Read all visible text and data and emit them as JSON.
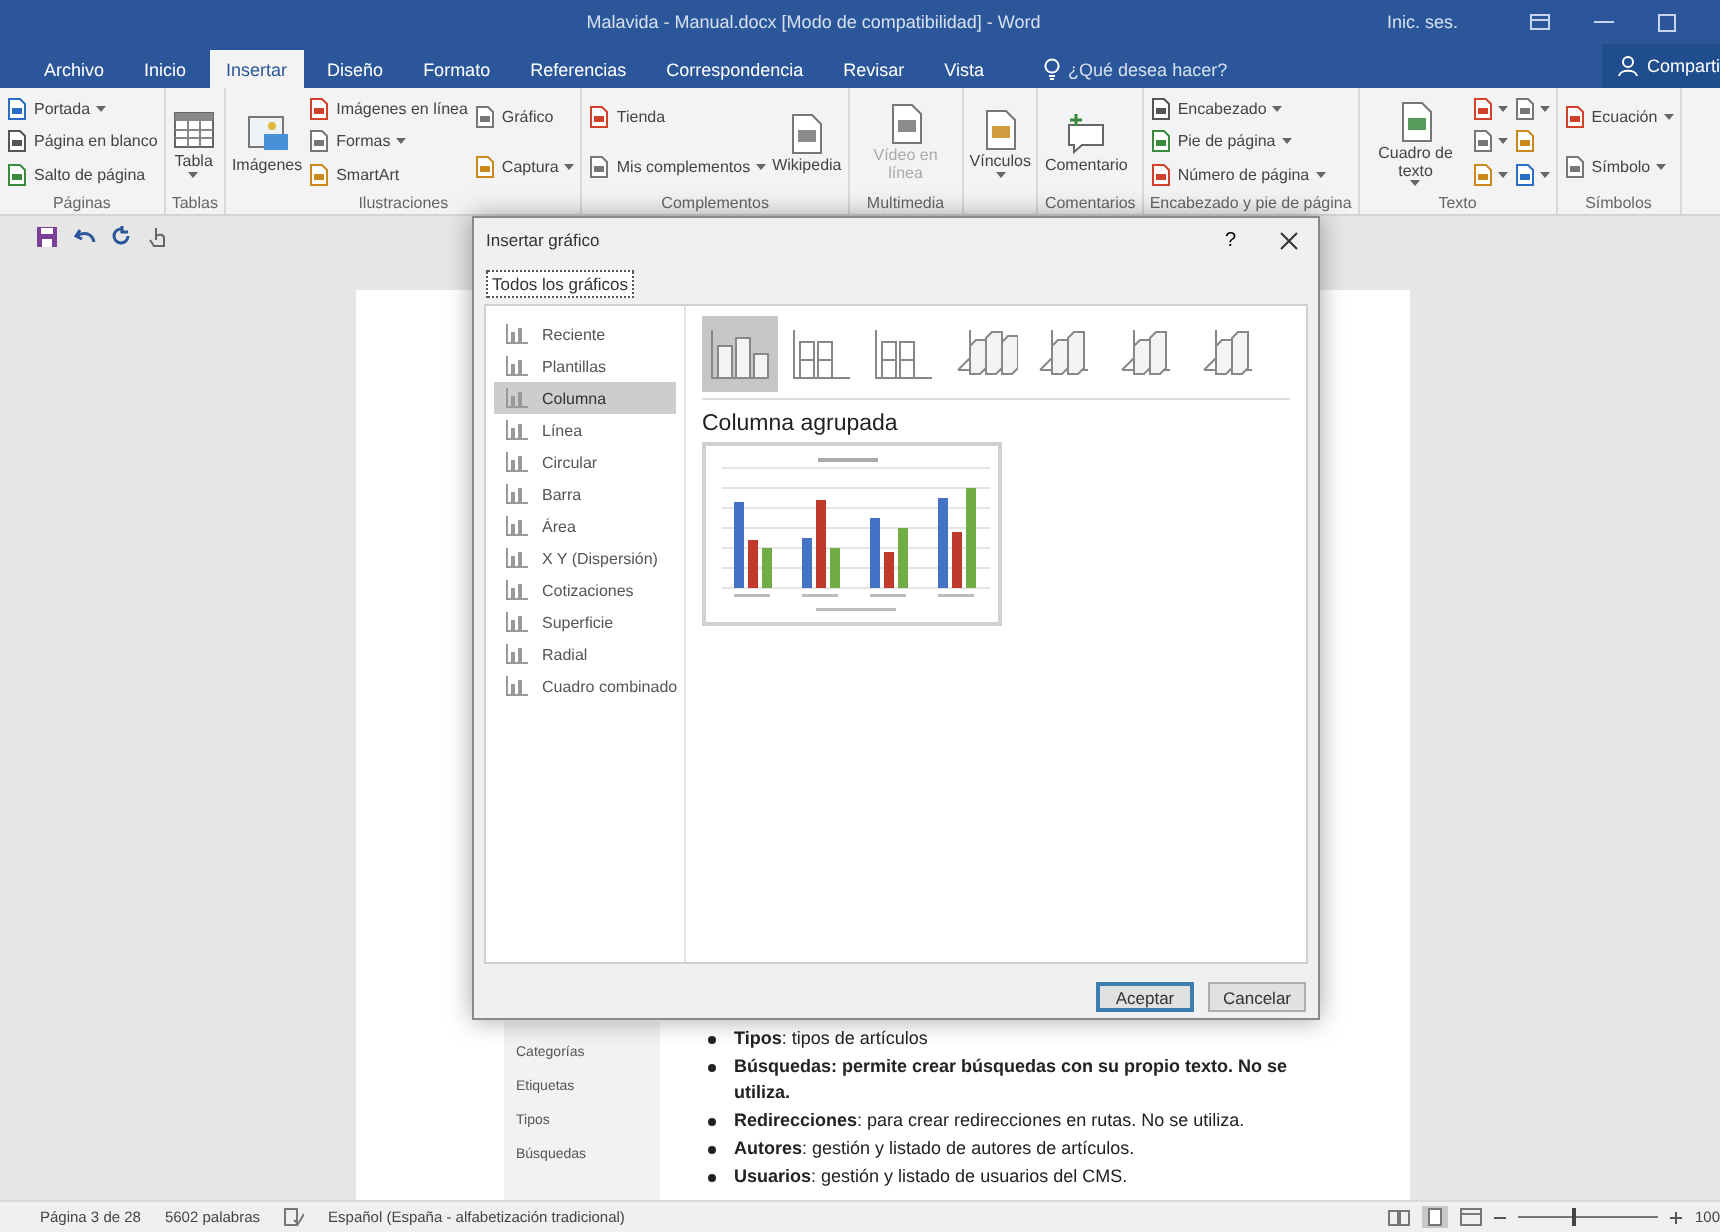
{
  "window": {
    "title": "Malavida - Manual.docx [Modo de compatibilidad] - Word",
    "account": "Inic. ses."
  },
  "tabs": [
    {
      "label": "Archivo",
      "selected": false
    },
    {
      "label": "Inicio",
      "selected": false
    },
    {
      "label": "Insertar",
      "selected": true
    },
    {
      "label": "Diseño",
      "selected": false
    },
    {
      "label": "Formato",
      "selected": false
    },
    {
      "label": "Referencias",
      "selected": false
    },
    {
      "label": "Correspondencia",
      "selected": false
    },
    {
      "label": "Revisar",
      "selected": false
    },
    {
      "label": "Vista",
      "selected": false
    }
  ],
  "tell_me": {
    "placeholder": "¿Qué desea hacer?"
  },
  "share_button": "Comparti",
  "ribbon_groups": [
    {
      "label": "Páginas",
      "columns": [
        [
          {
            "kind": "small",
            "label": "Portada",
            "dropdown": true,
            "disabled": false
          },
          {
            "kind": "small",
            "label": "Página en blanco",
            "dropdown": false,
            "disabled": false
          },
          {
            "kind": "small",
            "label": "Salto de página",
            "dropdown": false,
            "disabled": false
          }
        ]
      ]
    },
    {
      "label": "Tablas",
      "columns": [
        [
          {
            "kind": "large",
            "label": "Tabla",
            "dropdown": true,
            "disabled": false
          }
        ]
      ]
    },
    {
      "label": "Ilustraciones",
      "columns": [
        [
          {
            "kind": "large",
            "label": "Imágenes",
            "dropdown": false,
            "disabled": false
          }
        ],
        [
          {
            "kind": "small",
            "label": "Imágenes en línea",
            "dropdown": false,
            "disabled": false
          },
          {
            "kind": "small",
            "label": "Formas",
            "dropdown": true,
            "disabled": false
          },
          {
            "kind": "small",
            "label": "SmartArt",
            "dropdown": false,
            "disabled": false
          }
        ],
        [
          {
            "kind": "small",
            "label": "Gráfico",
            "dropdown": false,
            "disabled": false
          },
          {
            "kind": "small",
            "label": "Captura",
            "dropdown": true,
            "disabled": false
          }
        ]
      ]
    },
    {
      "label": "Complementos",
      "columns": [
        [
          {
            "kind": "small",
            "label": "Tienda",
            "dropdown": false,
            "disabled": false
          },
          {
            "kind": "small",
            "label": "Mis complementos",
            "dropdown": true,
            "disabled": false
          }
        ],
        [
          {
            "kind": "large",
            "label": "Wikipedia",
            "dropdown": false,
            "disabled": false
          }
        ]
      ]
    },
    {
      "label": "Multimedia",
      "columns": [
        [
          {
            "kind": "large",
            "label": "Vídeo en línea",
            "dropdown": false,
            "disabled": true
          }
        ]
      ]
    },
    {
      "columns": [
        [
          {
            "kind": "large",
            "label": "Vínculos",
            "dropdown": true,
            "disabled": false
          }
        ]
      ]
    },
    {
      "label": "Comentarios",
      "columns": [
        [
          {
            "kind": "large",
            "label": "Comentario",
            "dropdown": false,
            "disabled": false
          }
        ]
      ]
    },
    {
      "label": "Encabezado y pie de página",
      "columns": [
        [
          {
            "kind": "small",
            "label": "Encabezado",
            "dropdown": true,
            "disabled": false
          },
          {
            "kind": "small",
            "label": "Pie de página",
            "dropdown": true,
            "disabled": false
          },
          {
            "kind": "small",
            "label": "Número de página",
            "dropdown": true,
            "disabled": false
          }
        ]
      ]
    },
    {
      "label": "Texto",
      "columns": [
        [
          {
            "kind": "large",
            "label": "Cuadro de texto",
            "dropdown": true,
            "disabled": false
          }
        ],
        [
          {
            "kind": "icon",
            "dropdown": true,
            "disabled": false
          },
          {
            "kind": "icon",
            "dropdown": true,
            "disabled": false
          },
          {
            "kind": "icon",
            "dropdown": true,
            "disabled": false
          }
        ],
        [
          {
            "kind": "icon",
            "dropdown": true,
            "disabled": false
          },
          {
            "kind": "icon",
            "dropdown": false,
            "disabled": false
          },
          {
            "kind": "icon",
            "dropdown": true,
            "disabled": false
          }
        ]
      ]
    },
    {
      "label": "Símbolos",
      "columns": [
        [
          {
            "kind": "small",
            "label": "Ecuación",
            "dropdown": true,
            "disabled": false
          },
          {
            "kind": "small",
            "label": "Símbolo",
            "dropdown": true,
            "disabled": false
          }
        ]
      ]
    }
  ],
  "dialog": {
    "title": "Insertar gráfico",
    "help_button": "?",
    "tabs": [
      {
        "label": "Todos los gráficos",
        "selected": true
      }
    ],
    "chart_types": [
      {
        "label": "Reciente",
        "selected": false
      },
      {
        "label": "Plantillas",
        "selected": false
      },
      {
        "label": "Columna",
        "selected": true
      },
      {
        "label": "Línea",
        "selected": false
      },
      {
        "label": "Circular",
        "selected": false
      },
      {
        "label": "Barra",
        "selected": false
      },
      {
        "label": "Área",
        "selected": false
      },
      {
        "label": "X Y (Dispersión)",
        "selected": false
      },
      {
        "label": "Cotizaciones",
        "selected": false
      },
      {
        "label": "Superficie",
        "selected": false
      },
      {
        "label": "Radial",
        "selected": false
      },
      {
        "label": "Cuadro combinado",
        "selected": false
      }
    ],
    "subtypes": [
      {
        "selected": true
      },
      {
        "selected": false
      },
      {
        "selected": false
      },
      {
        "selected": false
      },
      {
        "selected": false
      },
      {
        "selected": false
      },
      {
        "selected": false
      }
    ],
    "subtype_title": "Columna agrupada",
    "buttons": [
      {
        "label": "Aceptar",
        "default": true
      },
      {
        "label": "Cancelar",
        "default": false
      }
    ]
  },
  "document": {
    "nav_items": [
      "Categorías",
      "Etiquetas",
      "Tipos",
      "Búsquedas"
    ],
    "bullets": [
      {
        "text": "**Tipos**: tipos de artículos",
        "bold": false
      },
      {
        "text": "Búsquedas: permite crear búsquedas con su propio texto. No se utiliza.",
        "bold": true
      },
      {
        "text": "**Redirecciones**: para crear redirecciones en rutas. No se utiliza.",
        "bold": false
      },
      {
        "text": "**Autores**: gestión y listado de autores de artículos.",
        "bold": false
      },
      {
        "text": "**Usuarios**: gestión y listado de usuarios del CMS.",
        "bold": false
      }
    ]
  },
  "status_bar": {
    "page": "Página 3 de 28",
    "words": "5602 palabras",
    "language": "Español (España - alfabetización tradicional)",
    "zoom": {
      "level": 0.4,
      "reading": "100"
    }
  }
}
